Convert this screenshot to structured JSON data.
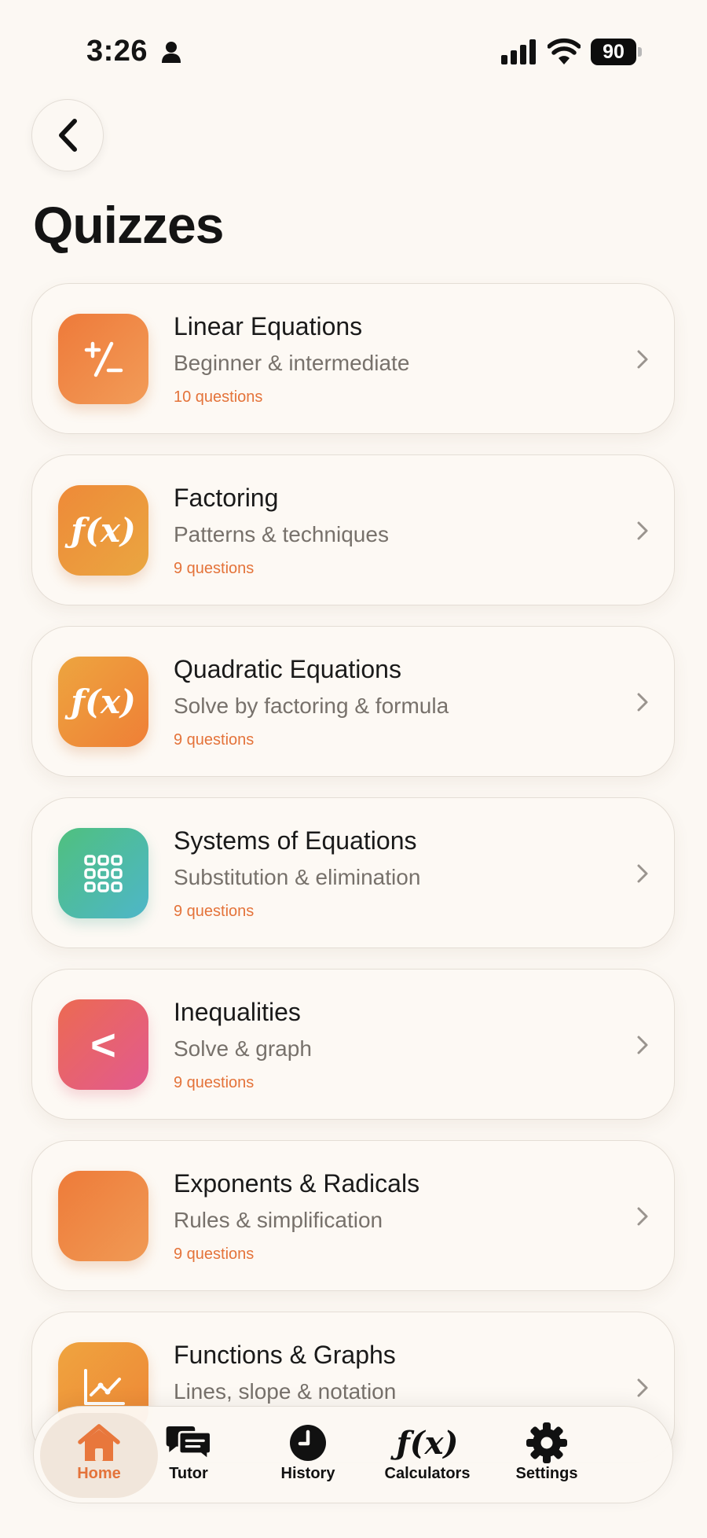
{
  "status_bar": {
    "time": "3:26",
    "battery": "90"
  },
  "page": {
    "title": "Quizzes"
  },
  "colors": {
    "accent": "#e4733a",
    "background": "#fcf8f3"
  },
  "quizzes": [
    {
      "title": "Linear Equations",
      "subtitle": "Beginner & intermediate",
      "count": "10 questions",
      "icon": "plus-minus-icon"
    },
    {
      "title": "Factoring",
      "subtitle": "Patterns & techniques",
      "count": "9 questions",
      "icon": "function-icon"
    },
    {
      "title": "Quadratic Equations",
      "subtitle": "Solve by factoring & formula",
      "count": "9 questions",
      "icon": "function-icon"
    },
    {
      "title": "Systems of Equations",
      "subtitle": "Substitution & elimination",
      "count": "9 questions",
      "icon": "grid-icon"
    },
    {
      "title": "Inequalities",
      "subtitle": "Solve & graph",
      "count": "9 questions",
      "icon": "less-than-icon"
    },
    {
      "title": "Exponents & Radicals",
      "subtitle": "Rules & simplification",
      "count": "9 questions",
      "icon": "blank-icon"
    },
    {
      "title": "Functions & Graphs",
      "subtitle": "Lines, slope & notation",
      "count": "",
      "icon": "line-chart-icon"
    }
  ],
  "tab_bar": {
    "tabs": [
      {
        "label": "Home",
        "icon": "home-icon",
        "active": true
      },
      {
        "label": "Tutor",
        "icon": "chat-icon",
        "active": false
      },
      {
        "label": "History",
        "icon": "clock-icon",
        "active": false
      },
      {
        "label": "Calculators",
        "icon": "function-icon",
        "active": false
      },
      {
        "label": "Settings",
        "icon": "gear-icon",
        "active": false
      }
    ]
  },
  "symbols": {
    "fx": "ƒ(x)",
    "lt": "<"
  }
}
